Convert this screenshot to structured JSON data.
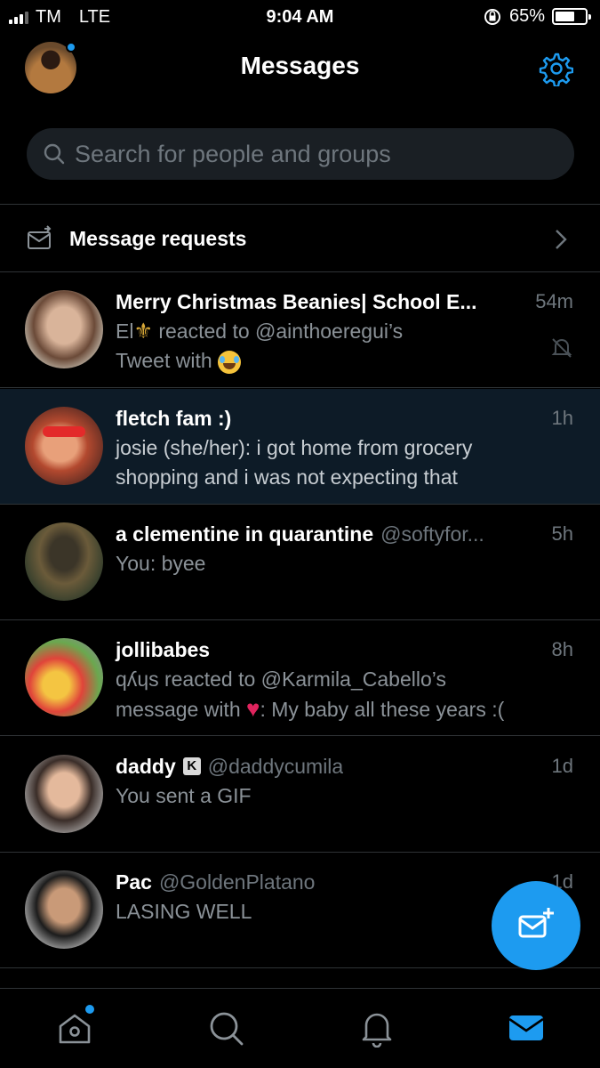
{
  "status_bar": {
    "carrier": "TM",
    "network": "LTE",
    "time": "9:04 AM",
    "battery": "65%",
    "battery_level": 0.65
  },
  "header": {
    "title": "Messages"
  },
  "search": {
    "placeholder": "Search for people and groups"
  },
  "requests": {
    "label": "Message requests"
  },
  "conversations": [
    {
      "name": "Merry Christmas Beanies| School E...",
      "handle": "",
      "time": "54m",
      "preview_a": "El",
      "preview_b": " reacted to @ainthoeregui’s",
      "preview_c": "Tweet with ",
      "muted": true,
      "highlight": false
    },
    {
      "name": "fletch fam :)",
      "handle": "",
      "time": "1h",
      "preview": "josie (she/her): i got home from grocery shopping and i was not expecting that",
      "highlight": true
    },
    {
      "name": "a clementine in quarantine",
      "handle": "@softyfor...",
      "time": "5h",
      "preview": "You: byee",
      "highlight": false
    },
    {
      "name": "jollibabes",
      "handle": "",
      "time": "8h",
      "preview_a": "qʎɥs reacted to @Karmila_Cabello’s",
      "preview_b": "message with ",
      "preview_c": ": My baby all these years :(",
      "highlight": false
    },
    {
      "name": "daddy",
      "badge": "K",
      "handle": "@daddycumila",
      "time": "1d",
      "preview": "You sent a GIF",
      "highlight": false
    },
    {
      "name": "Pac",
      "handle": "@GoldenPlatano",
      "time": "1d",
      "preview": "LASING WELL",
      "highlight": false
    }
  ],
  "icons": {
    "settings": "gear-icon",
    "search": "search-icon",
    "requests": "envelope-arrow-icon",
    "chevron": "chevron-right-icon",
    "mute": "bell-off-icon",
    "compose": "new-message-icon",
    "tab_home": "home-icon",
    "tab_search": "search-icon",
    "tab_notifications": "bell-icon",
    "tab_messages": "mail-icon"
  },
  "colors": {
    "accent": "#1d9bf0",
    "background": "#000000",
    "highlight_row": "#0d1b27",
    "muted_text": "#6e767d"
  }
}
